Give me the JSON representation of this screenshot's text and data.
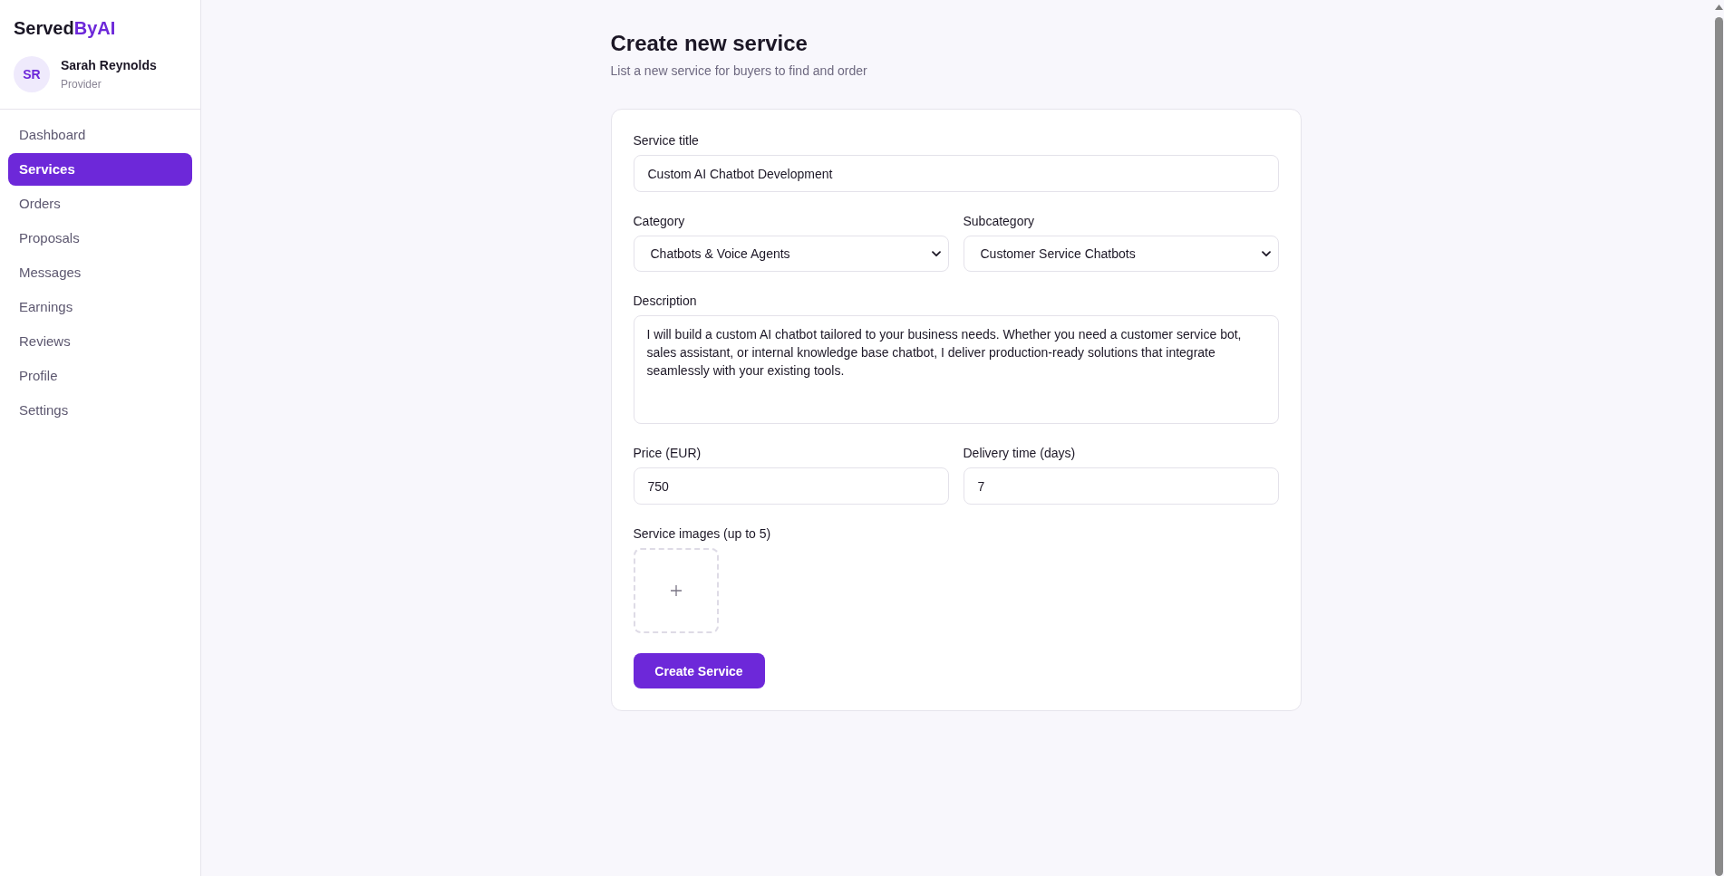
{
  "logo": {
    "text": "Served",
    "accent": "ByAI"
  },
  "user": {
    "initials": "SR",
    "name": "Sarah Reynolds",
    "role": "Provider"
  },
  "sidebar": {
    "items": [
      {
        "label": "Dashboard",
        "selected": false
      },
      {
        "label": "Services",
        "selected": true
      },
      {
        "label": "Orders",
        "selected": false
      },
      {
        "label": "Proposals",
        "selected": false
      },
      {
        "label": "Messages",
        "selected": false
      },
      {
        "label": "Earnings",
        "selected": false
      },
      {
        "label": "Reviews",
        "selected": false
      },
      {
        "label": "Profile",
        "selected": false
      },
      {
        "label": "Settings",
        "selected": false
      }
    ]
  },
  "page": {
    "title": "Create new service",
    "subtitle": "List a new service for buyers to find and order"
  },
  "form": {
    "rows": [
      {
        "fields": [
          {
            "kind": "text",
            "label": "Service title",
            "value": "Custom AI Chatbot Development"
          }
        ]
      },
      {
        "fields": [
          {
            "kind": "select",
            "label": "Category",
            "value": "Chatbots & Voice Agents"
          },
          {
            "kind": "select",
            "label": "Subcategory",
            "value": "Customer Service Chatbots"
          }
        ]
      },
      {
        "fields": [
          {
            "kind": "textarea",
            "label": "Description",
            "value": "I will build a custom AI chatbot tailored to your business needs. Whether you need a customer service bot, sales assistant, or internal knowledge base chatbot, I deliver production-ready solutions that integrate seamlessly with your existing tools."
          }
        ]
      },
      {
        "fields": [
          {
            "kind": "text",
            "label": "Price (EUR)",
            "value": "750"
          },
          {
            "kind": "text",
            "label": "Delivery time (days)",
            "value": "7"
          }
        ]
      },
      {
        "fields": [
          {
            "kind": "upload",
            "label": "Service images (up to 5)"
          }
        ]
      }
    ],
    "submit_button": "Create Service"
  }
}
